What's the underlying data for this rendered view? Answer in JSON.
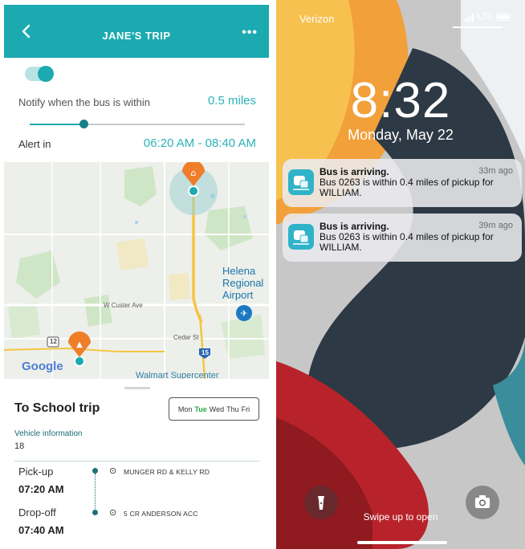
{
  "app": {
    "header": {
      "title": "JANE'S TRIP",
      "back_icon": "chevron-left-icon",
      "more_label": "•••"
    },
    "notify": {
      "enabled": true,
      "label": "Notify when the bus is within",
      "value": "0.5 miles",
      "slider_fraction": 0.25
    },
    "alert": {
      "label": "Alert in",
      "value": "06:20 AM - 08:40 AM"
    },
    "map": {
      "labels": {
        "street": "W Custer Ave",
        "cedar": "Cedar St",
        "route12": "12",
        "route15": "15"
      },
      "airport_line1": "Helena",
      "airport_line2": "Regional",
      "airport_line3": "Airport",
      "google": "Google",
      "cut_label": "Walmart Supercenter"
    },
    "trip": {
      "title": "To School trip",
      "days": [
        {
          "label": "Mon",
          "active": false
        },
        {
          "label": "Tue",
          "active": true
        },
        {
          "label": "Wed",
          "active": false
        },
        {
          "label": "Thu",
          "active": false
        },
        {
          "label": "Fri",
          "active": false
        }
      ],
      "vehicle_label": "Vehicle information",
      "vehicle_value": "18",
      "pickup": {
        "label": "Pick-up",
        "time": "07:20 AM",
        "address": "MUNGER RD & KELLY RD"
      },
      "dropoff": {
        "label": "Drop-off",
        "time": "07:40 AM",
        "address": "5 CR ANDERSON ACC"
      }
    },
    "colors": {
      "primary": "#1aaab0",
      "accent_text": "#2bb3b8",
      "active_day": "#2aa84a",
      "marker": "#f07d2a"
    }
  },
  "lock": {
    "carrier": "Verizon",
    "network": "LTE",
    "time": "8:32",
    "date": "Monday, May 22",
    "notifications": [
      {
        "title": "Bus is arriving.",
        "time": "33m ago",
        "body": "Bus 0263 is within 0.4 miles of pickup for WILLIAM."
      },
      {
        "title": "Bus is arriving.",
        "time": "39m ago",
        "body": "Bus 0263 is within 0.4 miles of pickup for WILLIAM."
      }
    ],
    "swipe_text": "Swipe up to open",
    "flashlight_icon": "flashlight-icon",
    "camera_icon": "camera-icon"
  }
}
